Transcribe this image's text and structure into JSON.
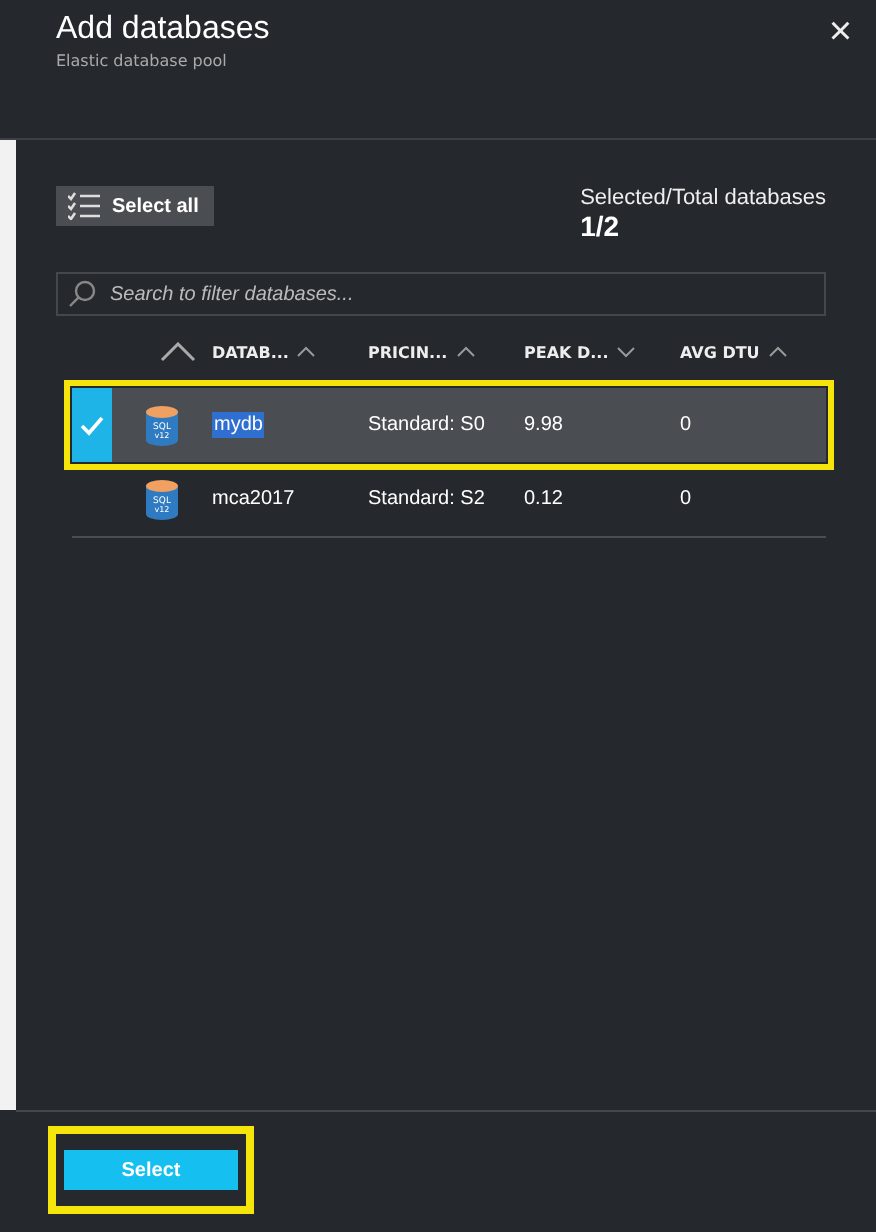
{
  "header": {
    "title": "Add databases",
    "subtitle": "Elastic database pool",
    "close": "×"
  },
  "toolbar": {
    "select_all": "Select all",
    "count_label": "Selected/Total databases",
    "count": "1/2"
  },
  "search": {
    "placeholder": "Search to filter databases..."
  },
  "columns": [
    {
      "label": "DATAB...",
      "sort_descending": false
    },
    {
      "label": "PRICIN...",
      "sort_descending": false
    },
    {
      "label": "PEAK D...",
      "sort_descending": true
    },
    {
      "label": "AVG DTU",
      "sort_descending": false
    }
  ],
  "rows": [
    {
      "selected": true,
      "name": "mydb",
      "name_highlighted": true,
      "pricing": "Standard: S0",
      "peak": "9.98",
      "avg": "0",
      "icon_label": "SQL",
      "icon_version": "v12"
    },
    {
      "selected": false,
      "name": "mca2017",
      "name_highlighted": false,
      "pricing": "Standard: S2",
      "peak": "0.12",
      "avg": "0",
      "icon_label": "SQL",
      "icon_version": "v12"
    }
  ],
  "footer": {
    "button": "Select"
  }
}
